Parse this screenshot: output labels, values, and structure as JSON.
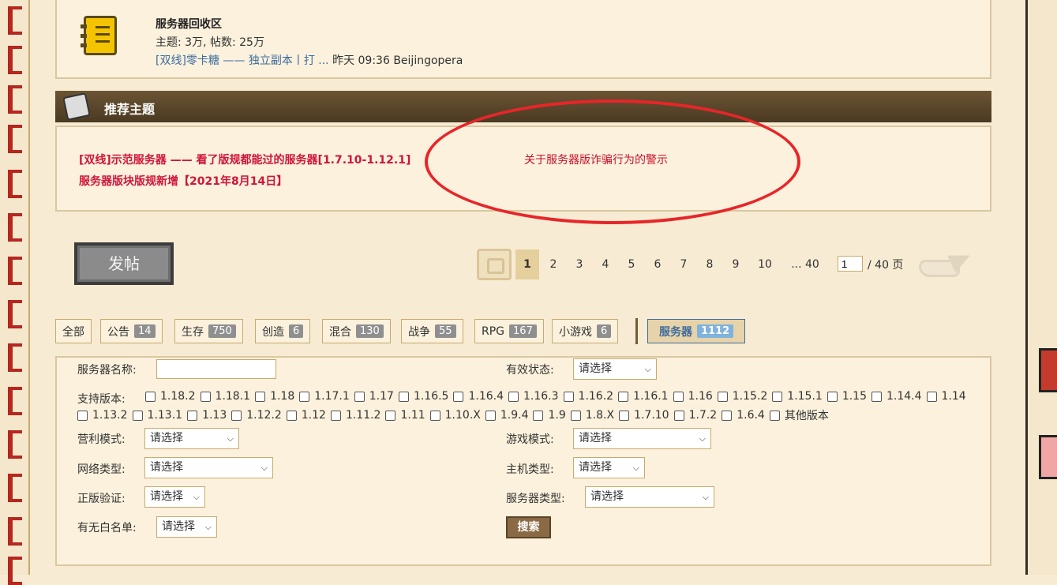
{
  "forum": {
    "title": "服务器回收区",
    "stats": "主题: 3万, 帖数: 25万",
    "last_post_link": "[双线]零卡糖 —— 独立副本丨打 ...",
    "last_post_meta": "昨天 09:36 Beijingopera",
    "icon": "notebook-icon"
  },
  "recommended": {
    "title": "推荐主题",
    "topics": [
      "[双线]示范服务器 —— 看了版规都能过的服务器[1.7.10-1.12.1]",
      "服务器版块版规新增【2021年8月14日】",
      "关于服务器版诈骗行为的警示"
    ],
    "annotation_color": "#e8252a"
  },
  "post_button": "发帖",
  "pager": {
    "pages": [
      "1",
      "2",
      "3",
      "4",
      "5",
      "6",
      "7",
      "8",
      "9",
      "10",
      "... 40"
    ],
    "current": "1",
    "input_value": "1",
    "total": "/ 40 页"
  },
  "tabs": [
    {
      "label": "全部",
      "count": ""
    },
    {
      "label": "公告",
      "count": "14"
    },
    {
      "label": "生存",
      "count": "750"
    },
    {
      "label": "创造",
      "count": "6"
    },
    {
      "label": "混合",
      "count": "130"
    },
    {
      "label": "战争",
      "count": "55"
    },
    {
      "label": "RPG",
      "count": "167"
    },
    {
      "label": "小游戏",
      "count": "6"
    },
    {
      "label": "服务器",
      "count": "1112"
    }
  ],
  "filters": {
    "server_name_label": "服务器名称:",
    "status_label": "有效状态:",
    "versions_label": "支持版本:",
    "versions_row1": [
      "1.18.2",
      "1.18.1",
      "1.18",
      "1.17.1",
      "1.17",
      "1.16.5",
      "1.16.4",
      "1.16.3",
      "1.16.2",
      "1.16.1",
      "1.16",
      "1.15.2",
      "1.15.1",
      "1.15",
      "1.14.4",
      "1.14"
    ],
    "versions_row2": [
      "1.13.2",
      "1.13.1",
      "1.13",
      "1.12.2",
      "1.12",
      "1.11.2",
      "1.11",
      "1.10.X",
      "1.9.4",
      "1.9",
      "1.8.X",
      "1.7.10",
      "1.7.2",
      "1.6.4",
      "其他版本"
    ],
    "profit_label": "营利模式:",
    "game_mode_label": "游戏模式:",
    "network_label": "网络类型:",
    "host_label": "主机类型:",
    "genuine_label": "正版验证:",
    "server_type_label": "服务器类型:",
    "whitelist_label": "有无白名单:",
    "select_placeholder": "请选择",
    "search_button": "搜索"
  }
}
